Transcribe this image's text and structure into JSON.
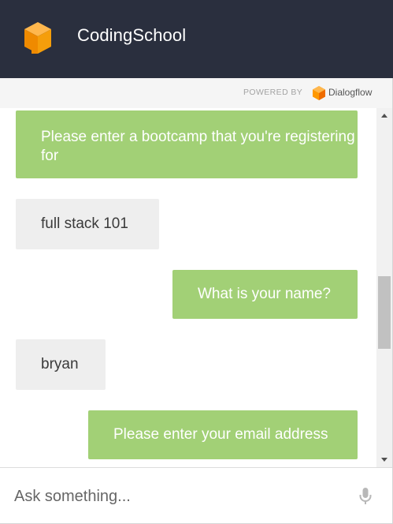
{
  "header": {
    "title": "CodingSchool",
    "logo_icon": "codingschool-cube-logo",
    "accent": "#f39200"
  },
  "powered": {
    "label": "POWERED BY",
    "brand": "Dialogflow",
    "brand_icon": "dialogflow-logo"
  },
  "conversation": {
    "messages": [
      {
        "from": "bot",
        "text": "Please enter a bootcamp that you're registering for"
      },
      {
        "from": "user",
        "text": "full stack 101"
      },
      {
        "from": "bot",
        "text": "What is your name?"
      },
      {
        "from": "user",
        "text": "bryan"
      },
      {
        "from": "bot",
        "text": "Please enter your email address"
      }
    ]
  },
  "input": {
    "placeholder": "Ask something...",
    "value": "",
    "mic_icon": "microphone-icon"
  },
  "colors": {
    "header_bg": "#2a2f3e",
    "bot_bubble": "#a2d076",
    "user_bubble": "#eeeeee"
  }
}
